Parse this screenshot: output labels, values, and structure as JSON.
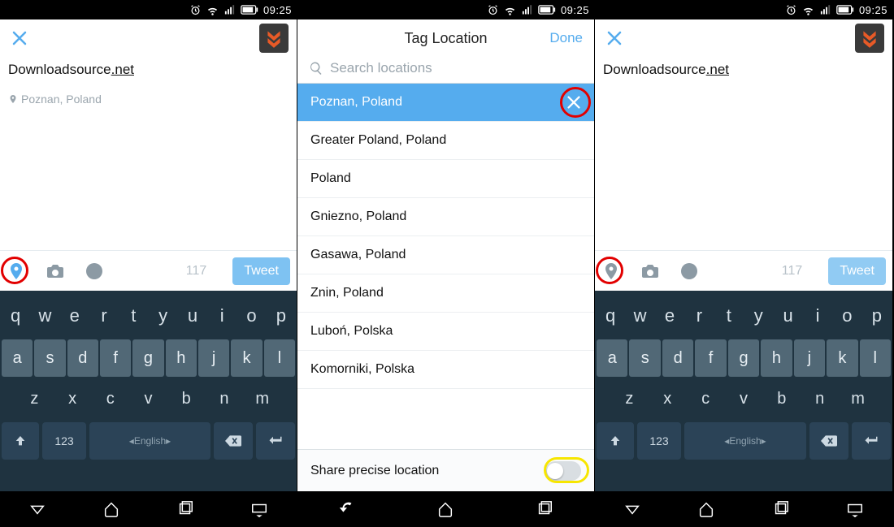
{
  "status": {
    "time": "09:25"
  },
  "compose": {
    "text_plain": "Downloadsource",
    "text_linked": ".net",
    "geo_label": "Poznan, Poland",
    "char_count": "117",
    "tweet_label": "Tweet"
  },
  "keyboard": {
    "row1": [
      "q",
      "w",
      "e",
      "r",
      "t",
      "y",
      "u",
      "i",
      "o",
      "p"
    ],
    "row2": [
      "a",
      "s",
      "d",
      "f",
      "g",
      "h",
      "j",
      "k",
      "l"
    ],
    "row3": [
      "z",
      "x",
      "c",
      "v",
      "b",
      "n",
      "m"
    ],
    "num_label": "123",
    "space_label": "English"
  },
  "tag": {
    "title": "Tag Location",
    "done": "Done",
    "search_placeholder": "Search locations",
    "items": [
      "Poznan, Poland",
      "Greater Poland, Poland",
      "Poland",
      "Gniezno, Poland",
      "Gasawa, Poland",
      "Znin, Poland",
      "Luboń, Polska",
      "Komorniki, Polska"
    ],
    "share_label": "Share precise location"
  }
}
